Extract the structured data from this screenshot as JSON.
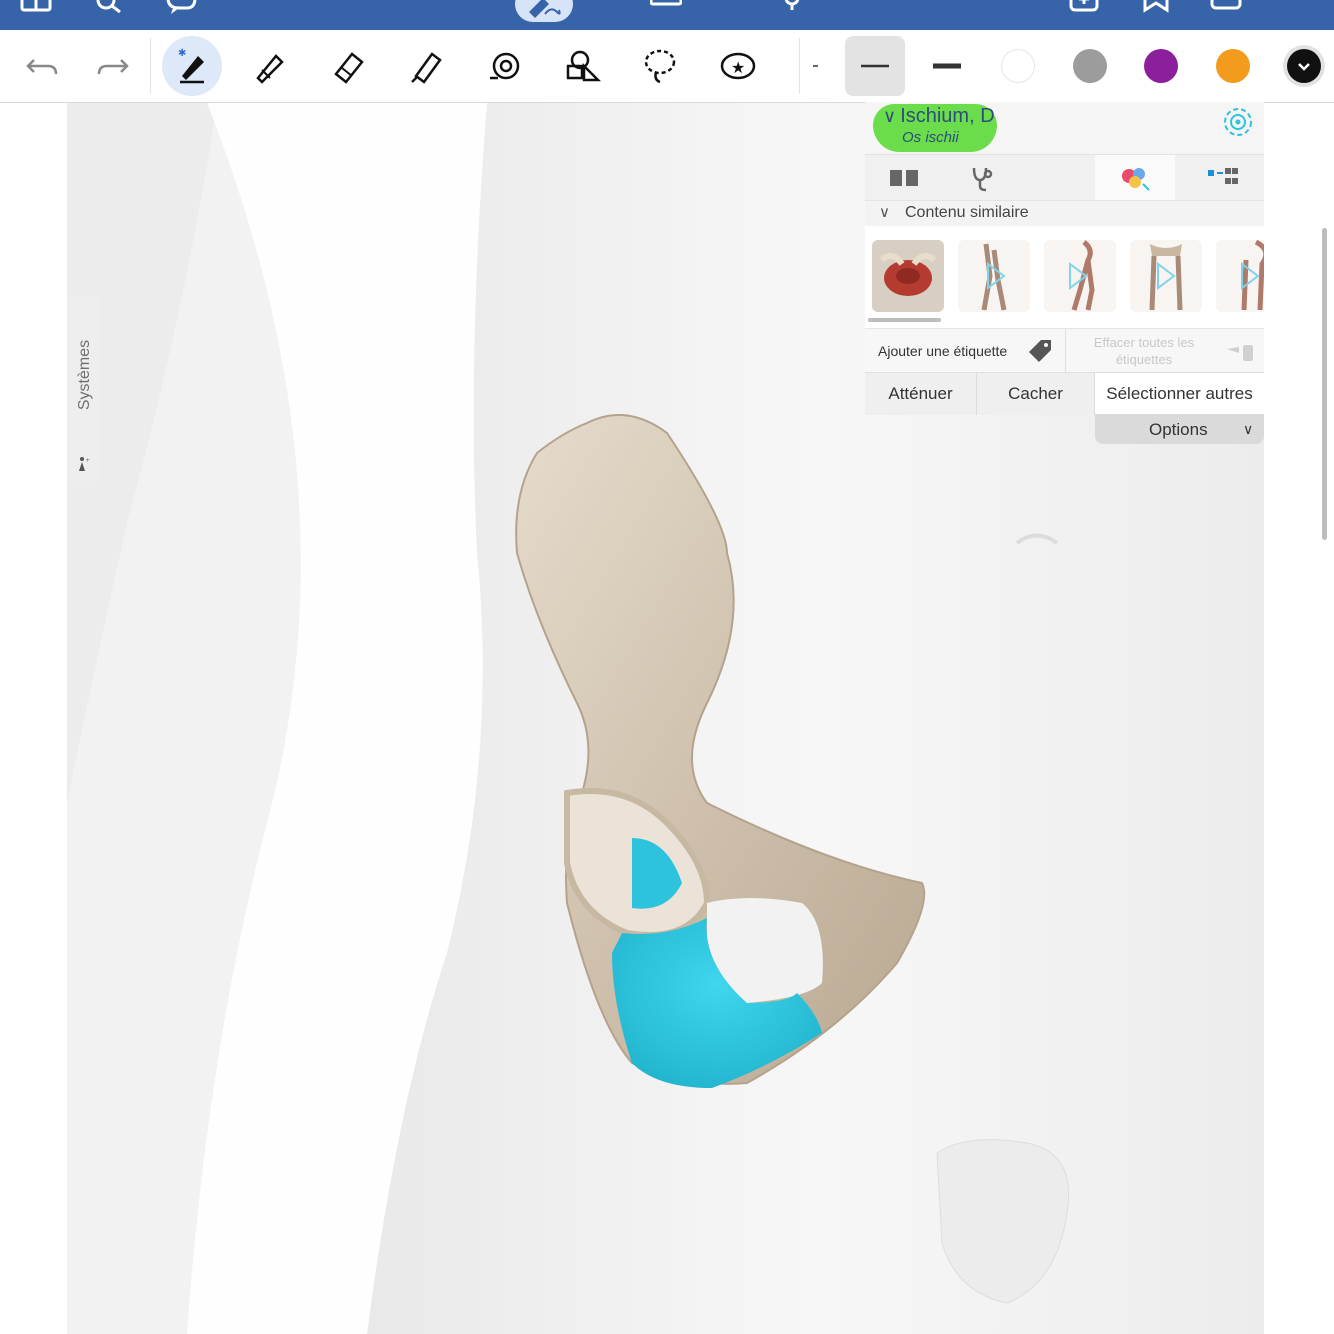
{
  "colors": {
    "system_bar": "#3763a8",
    "accent_blue": "#2b4e7e",
    "highlight_green": "#6bdc4a",
    "selected_bone": "#2ec3dc"
  },
  "topbar": {
    "icons": [
      "sidebar-icon",
      "search-icon",
      "comment-icon",
      "pen-badge-icon",
      "keyboard-icon",
      "presenter-icon",
      "add-page-icon",
      "bookmark-icon",
      "more-pages-icon"
    ]
  },
  "toolbar": {
    "tools": [
      {
        "name": "undo-icon"
      },
      {
        "name": "redo-icon"
      },
      {
        "name": "pen-tool-icon",
        "selected": true
      },
      {
        "name": "pencil-tool-icon"
      },
      {
        "name": "eraser-tool-icon"
      },
      {
        "name": "highlighter-tool-icon"
      },
      {
        "name": "spiral-tool-icon"
      },
      {
        "name": "shapes-tool-icon"
      },
      {
        "name": "lasso-tool-icon"
      },
      {
        "name": "sticker-tool-icon"
      }
    ],
    "stroke_sizes": [
      "thin",
      "medium",
      "thick"
    ],
    "stroke_selected": "medium",
    "swatches": [
      {
        "name": "white",
        "color": "#ffffff"
      },
      {
        "name": "gray",
        "color": "#9c9c9c"
      },
      {
        "name": "purple",
        "color": "#8c1f9b"
      },
      {
        "name": "orange",
        "color": "#f29b1d"
      },
      {
        "name": "black",
        "color": "#111111",
        "selected": true
      }
    ]
  },
  "sidebar": {
    "label": "Systèmes",
    "icon": "body-figure-icon"
  },
  "panel": {
    "title": "Ischium, D",
    "subtitle": "Os ischii",
    "tabs": [
      "book-icon",
      "stethoscope-icon",
      "muscles-icon",
      "hierarchy-icon"
    ],
    "active_tab": 2,
    "similar_content_label": "Contenu similaire",
    "thumbnails": [
      "pelvis-muscles-thumb",
      "leg-video-thumb",
      "hip-video-thumb",
      "pelvis-legs-video-thumb",
      "leg-video-thumb-2"
    ],
    "add_label": "Ajouter une étiquette",
    "clear_labels": "Effacer toutes les étiquettes",
    "buttons": {
      "fade": "Atténuer",
      "hide": "Cacher",
      "select_others": "Sélectionner autres"
    },
    "options_label": "Options"
  }
}
